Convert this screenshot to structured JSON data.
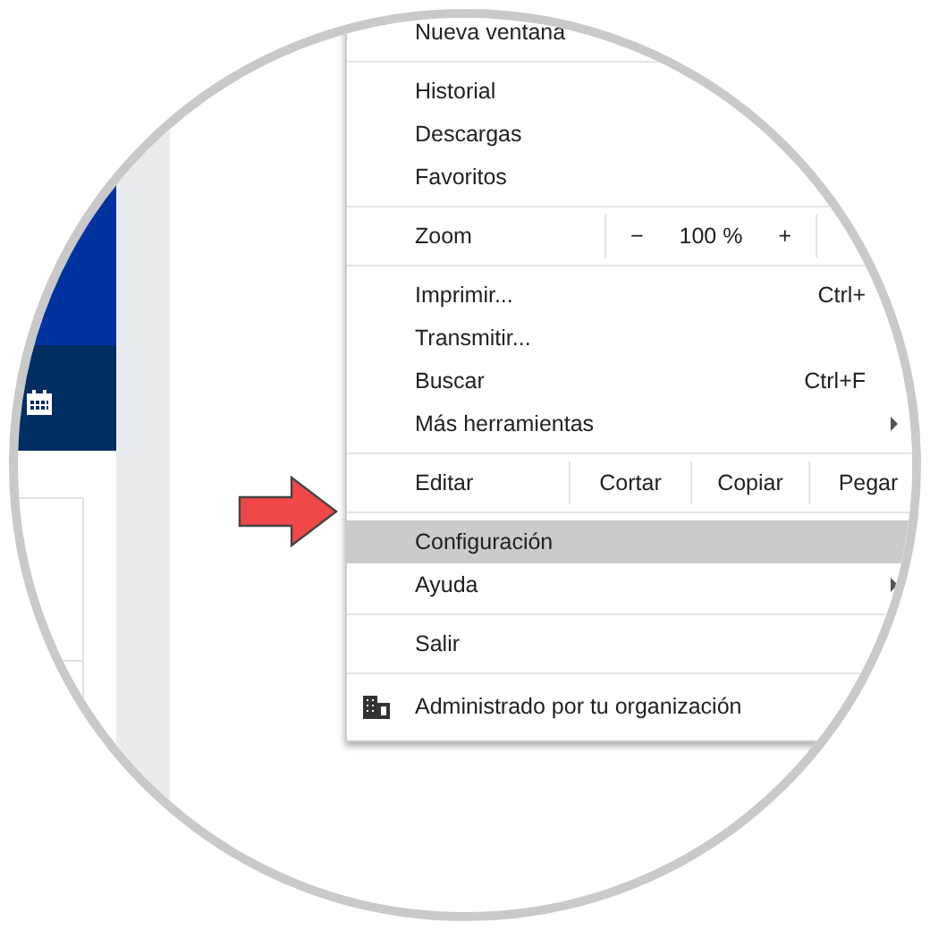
{
  "menu": {
    "items": [
      {
        "kind": "item",
        "label": "Nueva ventana",
        "highlighted": false,
        "submenu": false
      },
      {
        "kind": "separator"
      },
      {
        "kind": "item",
        "label": "Historial",
        "highlighted": false,
        "submenu": false
      },
      {
        "kind": "item",
        "label": "Descargas",
        "highlighted": false,
        "submenu": false
      },
      {
        "kind": "item",
        "label": "Favoritos",
        "highlighted": false,
        "submenu": false
      },
      {
        "kind": "separator"
      },
      {
        "kind": "zoom",
        "label": "Zoom",
        "minus": "−",
        "value": "100 %",
        "plus": "+"
      },
      {
        "kind": "separator"
      },
      {
        "kind": "item",
        "label": "Imprimir...",
        "shortcut": "Ctrl+",
        "highlighted": false,
        "submenu": false
      },
      {
        "kind": "item",
        "label": "Transmitir...",
        "highlighted": false,
        "submenu": false
      },
      {
        "kind": "item",
        "label": "Buscar",
        "shortcut": "Ctrl+F",
        "highlighted": false,
        "submenu": false
      },
      {
        "kind": "item",
        "label": "Más herramientas",
        "highlighted": false,
        "submenu": true
      },
      {
        "kind": "separator"
      },
      {
        "kind": "edit",
        "label": "Editar",
        "actions": [
          "Cortar",
          "Copiar",
          "Pegar"
        ]
      },
      {
        "kind": "separator"
      },
      {
        "kind": "item",
        "label": "Configuración",
        "highlighted": true,
        "submenu": false
      },
      {
        "kind": "item",
        "label": "Ayuda",
        "highlighted": false,
        "submenu": true
      },
      {
        "kind": "separator"
      },
      {
        "kind": "item",
        "label": "Salir",
        "highlighted": false,
        "submenu": false
      },
      {
        "kind": "separator"
      },
      {
        "kind": "managed",
        "label": "Administrado por tu organización"
      }
    ]
  }
}
